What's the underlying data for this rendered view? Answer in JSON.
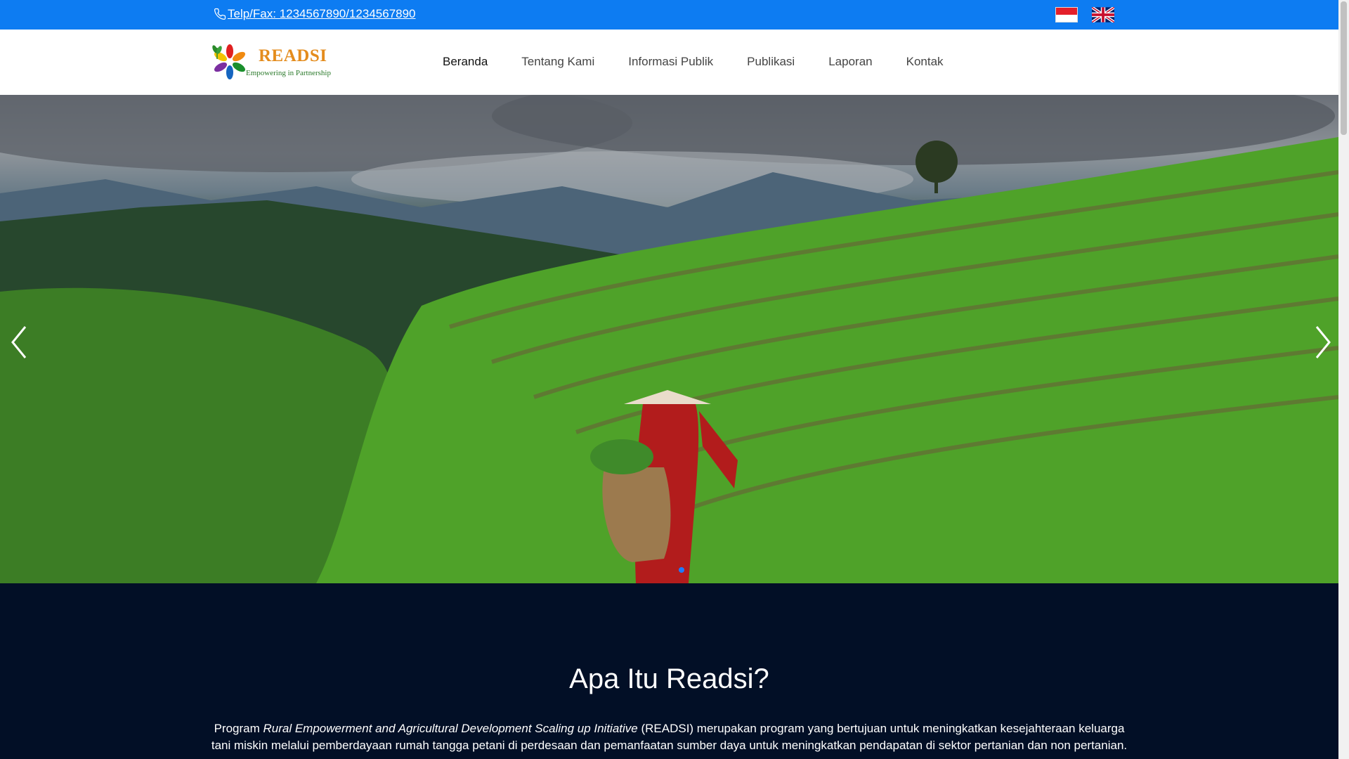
{
  "topbar": {
    "phone_label": "Telp/Fax: 1234567890/1234567890",
    "color": "#0d7cf2",
    "languages": [
      {
        "name": "Indonesian",
        "icon": "flag-id-icon"
      },
      {
        "name": "English",
        "icon": "flag-uk-icon"
      }
    ]
  },
  "logo": {
    "name": "READSI",
    "tagline": "Empowering in Partnership"
  },
  "nav": {
    "items": [
      {
        "label": "Beranda",
        "active": true
      },
      {
        "label": "Tentang Kami",
        "active": false
      },
      {
        "label": "Informasi Publik",
        "active": false
      },
      {
        "label": "Publikasi",
        "active": false
      },
      {
        "label": "Laporan",
        "active": false
      },
      {
        "label": "Kontak",
        "active": false
      }
    ]
  },
  "hero": {
    "prev_icon": "chevron-left-icon",
    "next_icon": "chevron-right-icon",
    "indicator_color": "#1e7bff"
  },
  "about": {
    "title": "Apa Itu Readsi?",
    "text_prefix": "Program ",
    "text_italic": "Rural Empowerment and Agricultural Development Scaling up Initiative",
    "text_suffix": " (READSI) merupakan program yang bertujuan untuk meningkatkan kesejahteraan keluarga tani miskin melalui pemberdayaan rumah tangga petani di perdesaan dan pemanfaatan sumber daya untuk meningkatkan pendapatan di sektor pertanian dan non pertanian.",
    "background": "#020f26"
  }
}
